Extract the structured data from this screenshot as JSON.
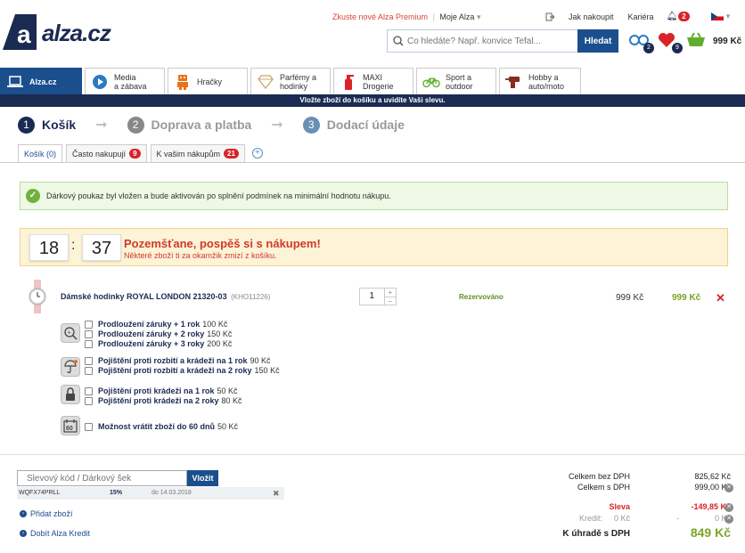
{
  "header": {
    "logo_text": "alza.cz",
    "promo_link": "Zkuste nové Alza Premium",
    "my_alza": "Moje Alza",
    "right_links": [
      "Jak nakoupit",
      "Kariéra"
    ],
    "notifications_count": "2",
    "search_placeholder": "Co hledáte? Např. konvice Tefal...",
    "search_button": "Hledat",
    "compare_count": "2",
    "favorites_count": "9",
    "cart_price": "999 Kč"
  },
  "categories": [
    {
      "label": "Alza.cz",
      "icon": "laptop-icon"
    },
    {
      "label": "Media\na zábava",
      "icon": "play-icon"
    },
    {
      "label": "Hračky",
      "icon": "robot-icon"
    },
    {
      "label": "Parfémy a\nhodinky",
      "icon": "diamond-icon"
    },
    {
      "label": "MAXI\nDrogerie",
      "icon": "spray-icon"
    },
    {
      "label": "Sport a\noutdoor",
      "icon": "bike-icon"
    },
    {
      "label": "Hobby a\nauto/moto",
      "icon": "drill-icon"
    }
  ],
  "banner": "Vložte zboží do košíku a uvidíte Vaši slevu.",
  "steps": [
    {
      "num": "1",
      "label": "Košík"
    },
    {
      "num": "2",
      "label": "Doprava a platba"
    },
    {
      "num": "3",
      "label": "Dodací údaje"
    }
  ],
  "subtabs": [
    {
      "label": "Košík (0)"
    },
    {
      "label": "Často nakupují",
      "badge": "9"
    },
    {
      "label": "K vašim nákupům",
      "badge": "21"
    }
  ],
  "success_msg": "Dárkový poukaz byl vložen a bude aktivován po splnění podmínek na minimální hodnotu nákupu.",
  "timer": {
    "minutes": "18",
    "seconds": "37",
    "title": "Pozemšťane, pospěš si s nákupem!",
    "subtitle": "Některé zboží ti za okamžik zmizí z košíku."
  },
  "product": {
    "name": "Dámské hodinky ROYAL LONDON 21320-03",
    "code": "(KHO11226)",
    "qty": "1",
    "status": "Rezervováno",
    "unit_price": "999 Kč",
    "total_price": "999 Kč"
  },
  "services": {
    "warranty": [
      {
        "name": "Prodloužení záruky + 1 rok",
        "price": "100 Kč"
      },
      {
        "name": "Prodloužení záruky + 2 roky",
        "price": "150 Kč"
      },
      {
        "name": "Prodloužení záruky + 3 roky",
        "price": "200 Kč"
      }
    ],
    "insurance": [
      {
        "name": "Pojištění proti rozbití a krádeži na 1 rok",
        "price": "90 Kč"
      },
      {
        "name": "Pojištění proti rozbití a krádeži na 2 roky",
        "price": "150 Kč"
      }
    ],
    "theft": [
      {
        "name": "Pojištění proti krádeži na 1 rok",
        "price": "50 Kč"
      },
      {
        "name": "Pojištění proti krádeži na 2 roky",
        "price": "80 Kč"
      }
    ],
    "return": [
      {
        "name": "Možnost vrátit zboží do 60 dnů",
        "price": "50 Kč"
      }
    ]
  },
  "coupon": {
    "placeholder": "Slevový kód / Dárkový šek",
    "button": "Vložit",
    "applied_code": "WQFX74PRLL",
    "applied_pct": "15%",
    "applied_valid": "do 14.03.2018"
  },
  "links": {
    "add_item": "Přidat zboží",
    "topup_credit": "Dobít Alza Kredit"
  },
  "totals": {
    "without_vat_label": "Celkem bez DPH",
    "without_vat": "825,62 Kč",
    "with_vat_label": "Celkem s DPH",
    "with_vat": "999,00 Kč",
    "discount_label": "Sleva",
    "discount": "-149,85 Kč",
    "credit_label": "Kredit:",
    "credit_left": "0 Kč",
    "credit_dash": "-",
    "credit_right": "0 Kč",
    "to_pay_label": "K úhradě s DPH",
    "to_pay": "849 Kč"
  },
  "colors": {
    "brand_navy": "#1b2a52",
    "brand_blue": "#1b4e8d",
    "price_green": "#7ba428",
    "alert_red": "#d03a2c"
  }
}
